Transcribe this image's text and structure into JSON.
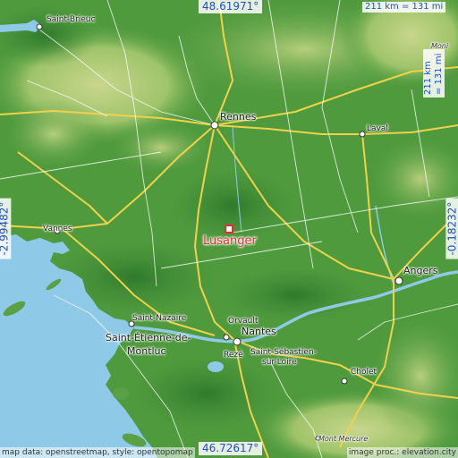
{
  "map": {
    "target": "Lusanger",
    "coords": {
      "north": "48.61971°",
      "south": "46.72617°",
      "west": "-2.99482°",
      "east": "-0.18232°"
    },
    "scale": {
      "horizontal": "211 km = 131 mi",
      "vertical": "211 km = 131 mi"
    },
    "attribution_left": "map data: openstreetmap, style: opentopomap",
    "attribution_right": "image proc.: elevation.city"
  },
  "places": {
    "saint_brieuc": "Saint-Brieuc",
    "rennes": "Rennes",
    "laval": "Laval",
    "vannes": "Vannes",
    "angers": "Angers",
    "saint_nazaire": "Saint-Nazaire",
    "saint_etienne_1": "Saint-Étienne-de-",
    "saint_etienne_2": "Montluc",
    "orvault": "Orvault",
    "nantes": "Nantes",
    "reze": "Rezé",
    "saint_sebastien_1": "Saint-Sébastien-",
    "saint_sebastien_2": "sur-Loire",
    "cholet": "Cholet",
    "mont_mercure": "Mont Mercure",
    "moni": "Moni"
  },
  "colors": {
    "water": "#8ec9e8",
    "land_low": "#4f9a3d",
    "land_high": "#9fc46a",
    "roads": "#f0d24a",
    "coord_text": "#1f4fc4",
    "target_marker": "#e23030"
  }
}
